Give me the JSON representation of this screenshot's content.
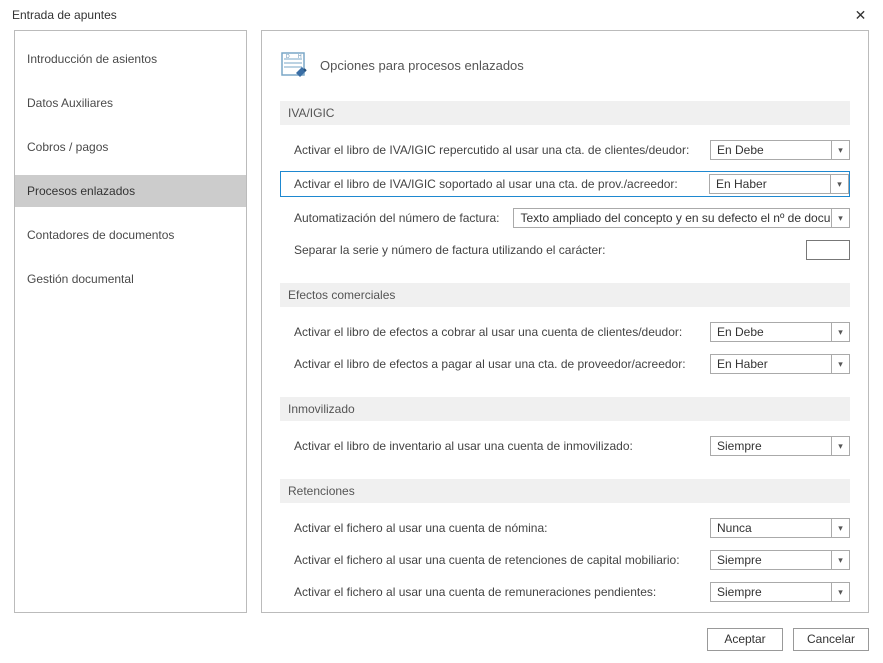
{
  "window": {
    "title": "Entrada de apuntes",
    "close_symbol": "✕"
  },
  "sidebar": {
    "items": [
      {
        "label": "Introducción de asientos"
      },
      {
        "label": "Datos Auxiliares"
      },
      {
        "label": "Cobros / pagos"
      },
      {
        "label": "Procesos enlazados"
      },
      {
        "label": "Contadores de documentos"
      },
      {
        "label": "Gestión documental"
      }
    ],
    "selected_index": 3
  },
  "header": {
    "title": "Opciones para procesos enlazados"
  },
  "sections": {
    "iva": {
      "title": "IVA/IGIC",
      "rows": [
        {
          "label": "Activar el libro de IVA/IGIC repercutido al usar una cta. de clientes/deudor:",
          "value": "En Debe"
        },
        {
          "label": "Activar el libro de IVA/IGIC soportado al usar una cta. de prov./acreedor:",
          "value": "En Haber"
        }
      ],
      "auto_label": "Automatización del número de factura:",
      "auto_value": "Texto ampliado del concepto y en su defecto el nº de docu",
      "sep_label": "Separar la serie y número de factura utilizando el carácter:",
      "sep_value": ""
    },
    "efectos": {
      "title": "Efectos comerciales",
      "rows": [
        {
          "label": "Activar el libro de efectos a cobrar al usar una cuenta de clientes/deudor:",
          "value": "En Debe"
        },
        {
          "label": "Activar el libro de efectos a pagar al usar una cta. de proveedor/acreedor:",
          "value": "En Haber"
        }
      ]
    },
    "inmovilizado": {
      "title": "Inmovilizado",
      "rows": [
        {
          "label": "Activar el libro de inventario al usar una cuenta de inmovilizado:",
          "value": "Siempre"
        }
      ]
    },
    "retenciones": {
      "title": "Retenciones",
      "rows": [
        {
          "label": "Activar el fichero al usar una cuenta de nómina:",
          "value": "Nunca"
        },
        {
          "label": "Activar el fichero al usar una cuenta de retenciones de capital mobiliario:",
          "value": "Siempre"
        },
        {
          "label": "Activar el fichero al usar una cuenta de remuneraciones pendientes:",
          "value": "Siempre"
        }
      ]
    }
  },
  "footer": {
    "accept": "Aceptar",
    "cancel": "Cancelar"
  }
}
